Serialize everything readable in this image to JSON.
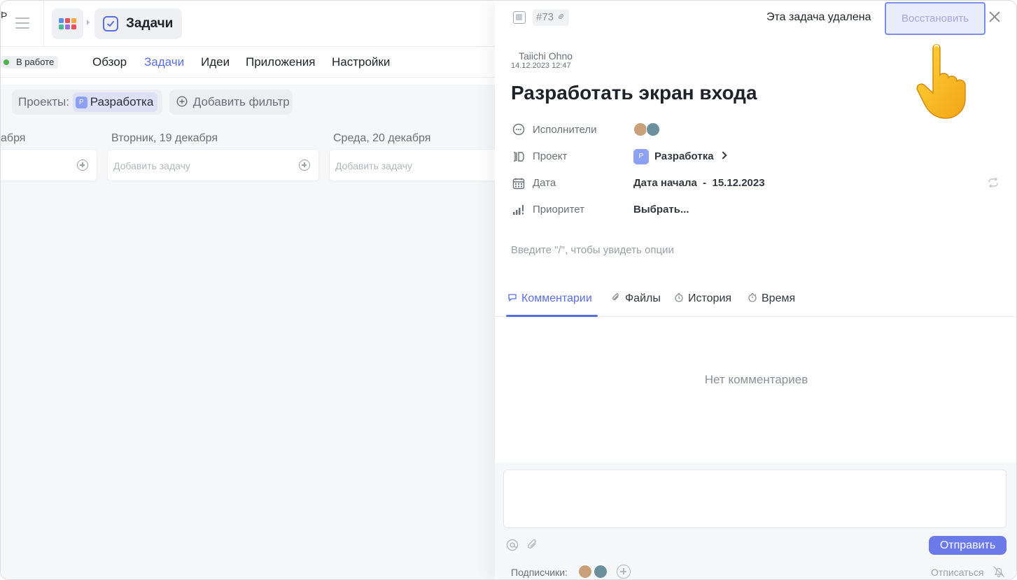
{
  "topbar": {
    "corner_glyph": "Þ",
    "section_title": "Задачи"
  },
  "subnav": {
    "status": "В работе",
    "items": [
      "Обзор",
      "Задачи",
      "Идеи",
      "Приложения",
      "Настройки"
    ],
    "active_index": 1
  },
  "filters": {
    "projects_label": "Проекты:",
    "project_badge": "P",
    "project_value": "Разработка",
    "add_filter": "Добавить фильтр"
  },
  "board": {
    "columns": [
      {
        "title": "абря",
        "placeholder": ""
      },
      {
        "title": "Вторник, 19 декабря",
        "placeholder": "Добавить задачу"
      },
      {
        "title": "Среда, 20 декабря",
        "placeholder": "Добавить задачу"
      }
    ]
  },
  "panel": {
    "task_id": "#73",
    "deleted_notice": "Эта задача удалена",
    "restore_label": "Восстановить",
    "author": "Taiichi Ohno",
    "created_at": "14.12.2023 12:47",
    "title": "Разработать экран входа",
    "props": {
      "assignees_label": "Исполнители",
      "project_label": "Проект",
      "project_badge": "P",
      "project_value": "Разработка",
      "date_label": "Дата",
      "date_value": "Дата начала  -  15.12.2023",
      "priority_label": "Приоритет",
      "priority_value": "Выбрать..."
    },
    "editor_placeholder": "Введите \"/\", чтобы увидеть опции",
    "tabs": [
      "Комментарии",
      "Файлы",
      "История",
      "Время"
    ],
    "active_tab": 0,
    "empty_comments": "Нет комментариев",
    "send_label": "Отправить",
    "subscribers_label": "Подписчики:",
    "unsubscribe_label": "Отписаться"
  },
  "colors": {
    "accent": "#5b6ee1",
    "status_dot": "#4cb34c",
    "badge": "#8ea0f3"
  },
  "icons": [
    "hamburger-icon",
    "apps-grid-icon",
    "check-square-icon",
    "filter-plus-icon",
    "document-icon",
    "link-icon",
    "close-icon",
    "pointing-hand-icon",
    "assignees-icon",
    "project-icon",
    "calendar-icon",
    "priority-icon",
    "repeat-icon",
    "comment-icon",
    "paperclip-icon",
    "history-icon",
    "timer-icon",
    "mention-icon",
    "bell-off-icon"
  ]
}
